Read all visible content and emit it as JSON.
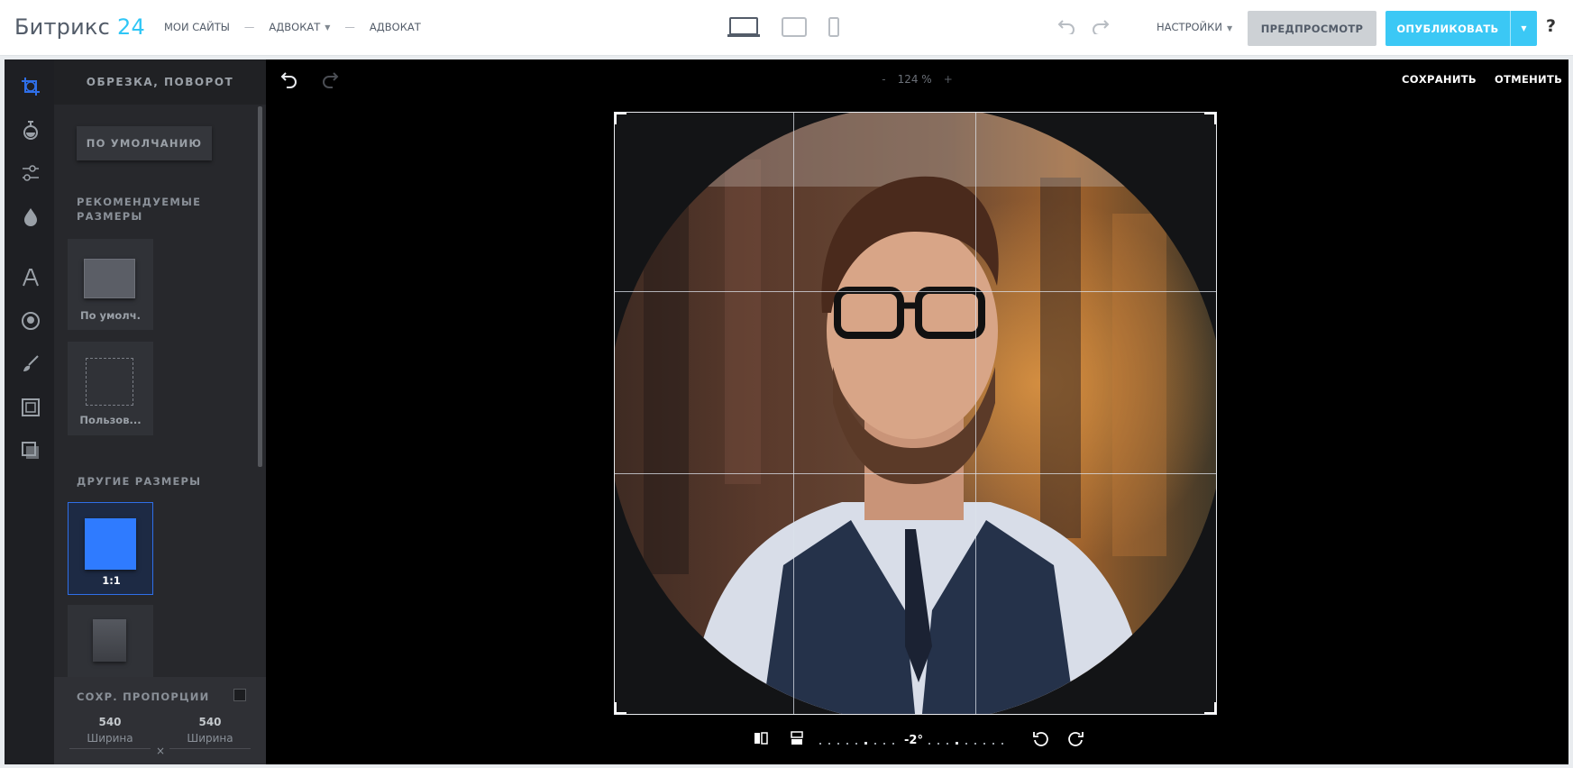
{
  "header": {
    "logo_text": "Битрикс",
    "logo_number": "24",
    "breadcrumbs": [
      "МОИ САЙТЫ",
      "АДВОКАТ",
      "АДВОКАТ"
    ],
    "breadcrumb_separator": "—",
    "settings_label": "НАСТРОЙКИ",
    "preview_label": "ПРЕДПРОСМОТР",
    "publish_label": "ОПУБЛИКОВАТЬ",
    "help_label": "?",
    "accent_color": "#2fc6f6"
  },
  "editor": {
    "panel_title": "ОБРЕЗКА, ПОВОРОТ",
    "default_button": "ПО УМОЛЧАНИЮ",
    "recommended_title": "РЕКОМЕНДУЕМЫЕ РАЗМЕРЫ",
    "recommended": [
      {
        "label": "По умолч."
      },
      {
        "label": "Пользов..."
      }
    ],
    "other_title": "ДРУГИЕ РАЗМЕРЫ",
    "other": [
      {
        "label": "1:1",
        "selected": true
      },
      {
        "label": ""
      }
    ],
    "keep_proportions_label": "СОХР. ПРОПОРЦИИ",
    "keep_proportions_checked": false,
    "width_value": "540",
    "width_label": "Ширина",
    "height_value": "540",
    "height_label": "Ширина",
    "dimension_separator": "×",
    "zoom_minus": "-",
    "zoom_value": "124 %",
    "zoom_plus": "+",
    "save_label": "СОХРАНИТЬ",
    "cancel_label": "ОТМЕНИТЬ",
    "rotation_value": "-2°",
    "crop_ratio": "1:1",
    "tools": [
      "crop-icon",
      "filter-icon",
      "adjust-icon",
      "drop-icon",
      "text-icon",
      "sticker-icon",
      "brush-icon",
      "frame-icon",
      "overlay-icon"
    ]
  }
}
